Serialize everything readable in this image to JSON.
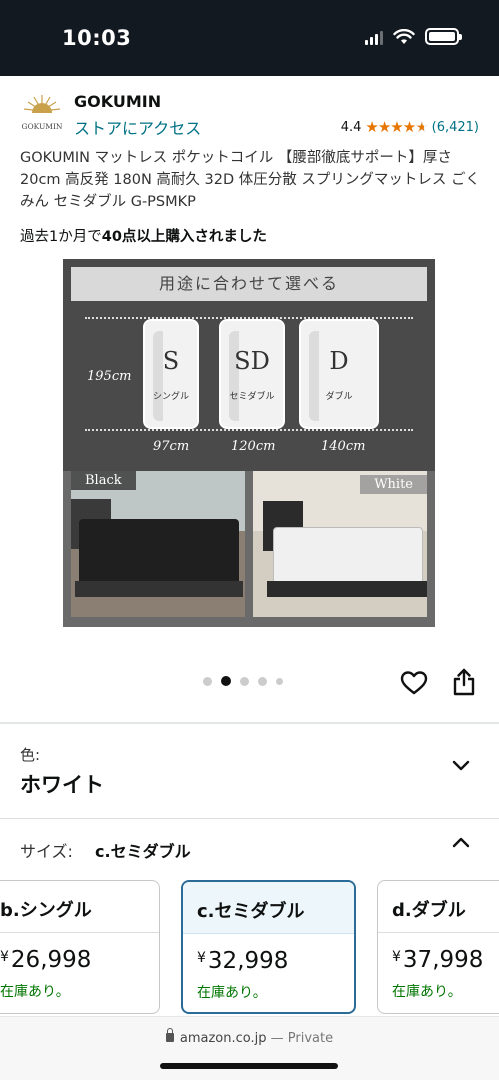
{
  "status_bar": {
    "time": "10:03"
  },
  "brand": {
    "logo_text": "GOKUMIN",
    "name": "GOKUMIN",
    "store_link": "ストアにアクセス",
    "rating": "4.4",
    "rating_value": 4.4,
    "rating_count": "(6,421)",
    "accent": "#e77600"
  },
  "product": {
    "title": "GOKUMIN マットレス ポケットコイル 【腰部徹底サポート】厚さ20cm 高反発 180N 高耐久 32D 体圧分散 スプリングマットレス ごくみん セミダブル G-PSMKP",
    "purchase_prefix": "過去1か月で",
    "purchase_bold": "40点以上購入されました"
  },
  "image": {
    "banner": "用途に合わせて選べる",
    "height_label": "195cm",
    "cards": [
      {
        "letter": "S",
        "sub": "シングル",
        "width": "97cm"
      },
      {
        "letter": "SD",
        "sub": "セミダブル",
        "width": "120cm"
      },
      {
        "letter": "D",
        "sub": "ダブル",
        "width": "140cm"
      }
    ],
    "label_black": "Black",
    "label_white": "White"
  },
  "carousel": {
    "count": 5,
    "active_index": 1
  },
  "color": {
    "label": "色:",
    "value": "ホワイト"
  },
  "size": {
    "label": "サイズ:",
    "value": "c.セミダブル",
    "options": [
      {
        "name": "b.シングル",
        "currency": "¥",
        "price": "26,998",
        "stock": "在庫あり。"
      },
      {
        "name": "c.セミダブル",
        "currency": "¥",
        "price": "32,998",
        "stock": "在庫あり。"
      },
      {
        "name": "d.ダブル",
        "currency": "¥",
        "price": "37,998",
        "stock": "在庫あり。"
      }
    ]
  },
  "browser": {
    "domain": "amazon.co.jp",
    "separator": "—",
    "mode": "Private"
  }
}
